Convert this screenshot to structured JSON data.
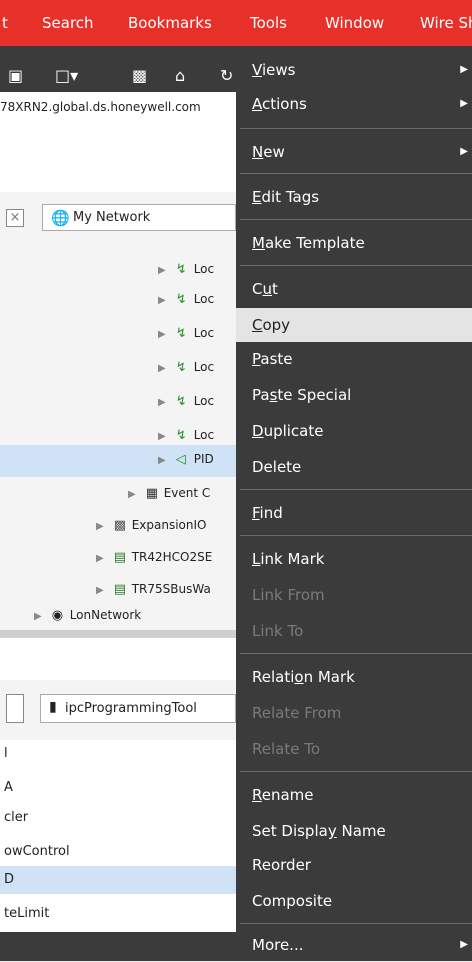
{
  "menubar": {
    "items": [
      {
        "label": "Search"
      },
      {
        "label": "Bookmarks"
      },
      {
        "label": "Tools"
      },
      {
        "label": "Window"
      },
      {
        "label": "Wire Sh"
      }
    ],
    "cut_prefix": "t"
  },
  "address": "78XRN2.global.ds.honeywell.com",
  "nav": {
    "network_label": "My Network",
    "rows": [
      {
        "label": "Loc",
        "icon": "link-icon"
      },
      {
        "label": "Loc",
        "icon": "link-icon"
      },
      {
        "label": "Loc",
        "icon": "link-icon"
      },
      {
        "label": "Loc",
        "icon": "link-icon"
      },
      {
        "label": "Loc",
        "icon": "link-icon"
      },
      {
        "label": "Loc",
        "icon": "link-icon"
      },
      {
        "label": "PID",
        "icon": "pid-icon"
      },
      {
        "label": "Event C",
        "icon": "calendar-icon"
      },
      {
        "label": "ExpansionIO",
        "icon": "folder-icon"
      },
      {
        "label": "TR42HCO2SE",
        "icon": "device-icon"
      },
      {
        "label": "TR75SBusWa",
        "icon": "device-icon"
      },
      {
        "label": "LonNetwork",
        "icon": "network-icon"
      }
    ]
  },
  "props": {
    "tool_label": "ipcProgrammingTool",
    "rows": [
      {
        "label": "l"
      },
      {
        "label": "A"
      },
      {
        "label": "cler"
      },
      {
        "label": "owControl"
      },
      {
        "label": "D"
      },
      {
        "label": "teLimit"
      }
    ]
  },
  "menu": {
    "views": {
      "pre": "",
      "key": "V",
      "post": "iews"
    },
    "actions": {
      "pre": "",
      "key": "A",
      "post": "ctions"
    },
    "new": {
      "pre": "",
      "key": "N",
      "post": "ew"
    },
    "edit_tags": {
      "pre": "",
      "key": "E",
      "post": "dit Tags"
    },
    "make_template": {
      "pre": "",
      "key": "M",
      "post": "ake Template"
    },
    "cut": {
      "pre": "C",
      "key": "u",
      "post": "t"
    },
    "copy": {
      "pre": "",
      "key": "C",
      "post": "opy"
    },
    "paste": {
      "pre": "",
      "key": "P",
      "post": "aste"
    },
    "paste_special": {
      "pre": "Pa",
      "key": "s",
      "post": "te Special"
    },
    "duplicate": {
      "pre": "",
      "key": "D",
      "post": "uplicate"
    },
    "delete": "Delete",
    "find": {
      "pre": "",
      "key": "F",
      "post": "ind"
    },
    "link_mark": {
      "pre": "",
      "key": "L",
      "post": "ink Mark"
    },
    "link_from": "Link From",
    "link_to": "Link To",
    "relation_mark": {
      "pre": "Relati",
      "key": "o",
      "post": "n Mark"
    },
    "relate_from": "Relate From",
    "relate_to": "Relate To",
    "rename": {
      "pre": "",
      "key": "R",
      "post": "ename"
    },
    "set_display_name": {
      "pre": "Set Displa",
      "key": "y",
      "post": " Name"
    },
    "reorder": "Reorder",
    "composite": "Composite",
    "more": "More..."
  }
}
